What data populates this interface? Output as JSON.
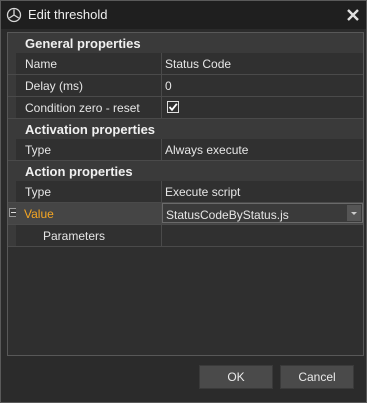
{
  "window": {
    "title": "Edit threshold"
  },
  "grid": {
    "general": {
      "header": "General properties",
      "name": {
        "label": "Name",
        "value": "Status Code"
      },
      "delay": {
        "label": "Delay (ms)",
        "value": "0"
      },
      "condition_zero_reset": {
        "label": "Condition zero - reset",
        "checked": true,
        "check_glyph": "☑"
      }
    },
    "activation": {
      "header": "Activation properties",
      "type": {
        "label": "Type",
        "value": "Always execute"
      }
    },
    "action": {
      "header": "Action properties",
      "type": {
        "label": "Type",
        "value": "Execute script"
      },
      "value": {
        "label": "Value",
        "value": "StatusCodeByStatus.js"
      },
      "parameters": {
        "label": "Parameters",
        "value": ""
      }
    }
  },
  "buttons": {
    "ok": "OK",
    "cancel": "Cancel"
  },
  "colors": {
    "accent": "#f5a623",
    "background": "#2b2b2b",
    "titlebar": "#1f1f1f"
  }
}
